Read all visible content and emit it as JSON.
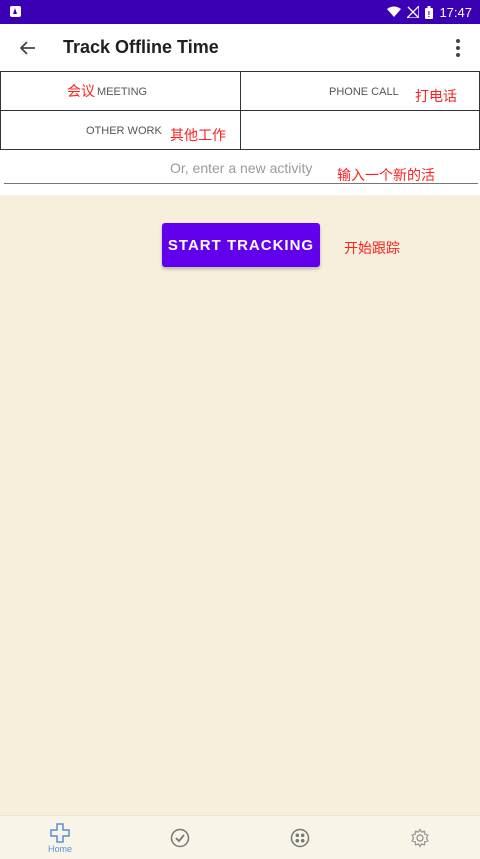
{
  "status": {
    "time": "17:47"
  },
  "app_bar": {
    "title": "Track Offline Time"
  },
  "activities": [
    {
      "label": "MEETING",
      "note": "会议"
    },
    {
      "label": "PHONE CALL",
      "note": "打电话"
    },
    {
      "label": "OTHER WORK",
      "note": "其他工作"
    },
    {
      "label": "",
      "note": ""
    }
  ],
  "new_activity": {
    "placeholder": "Or, enter a new activity",
    "note": "输入一个新的活"
  },
  "start_button": {
    "label": "START TRACKING",
    "note": "开始跟踪"
  },
  "bottom_nav": [
    {
      "icon": "home-plus-icon",
      "label": "Home"
    },
    {
      "icon": "check-circle-icon",
      "label": ""
    },
    {
      "icon": "apps-icon",
      "label": ""
    },
    {
      "icon": "settings-gear-icon",
      "label": ""
    }
  ],
  "colors": {
    "status_bar": "#3c00b4",
    "accent": "#6200ee",
    "annotation": "#ff2020",
    "content_bg": "#f5efdc"
  }
}
